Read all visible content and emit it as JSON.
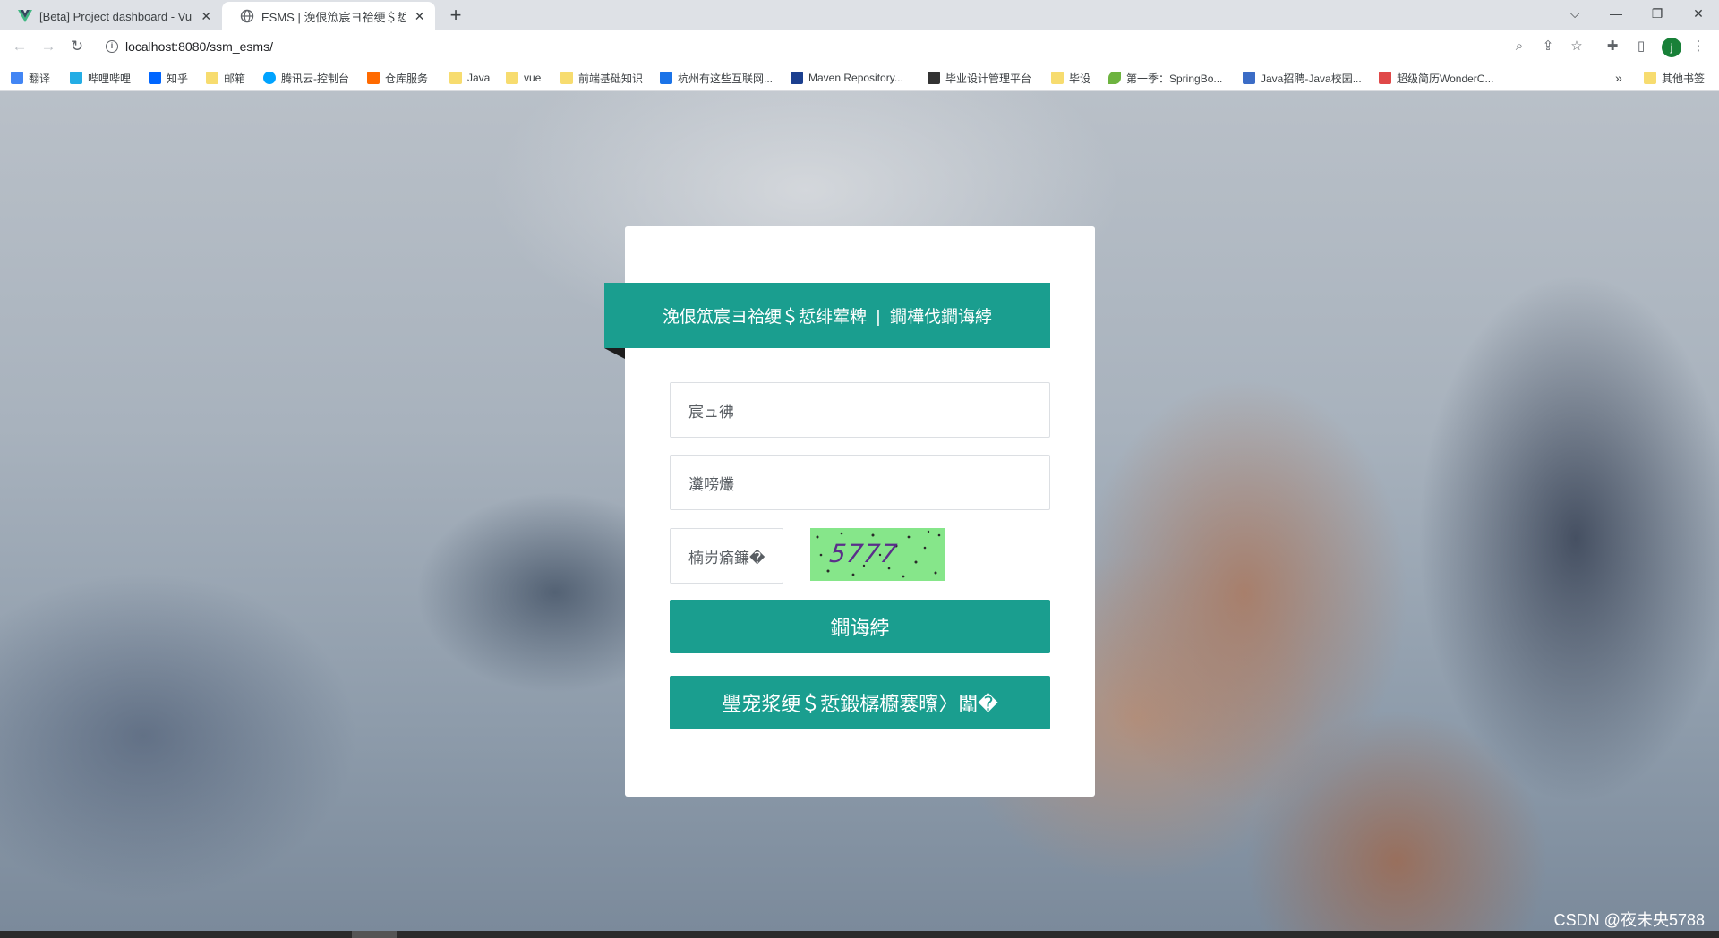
{
  "browser": {
    "tabs": [
      {
        "title": "[Beta] Project dashboard - Vue",
        "icon": "vue-logo-icon"
      },
      {
        "title": "ESMS | 浼佷笟宸ヨ祫绠＄悊绯荤粺",
        "icon": "globe-icon",
        "active": true
      }
    ],
    "url": "localhost:8080/ssm_esms/",
    "profile_initial": "j",
    "bookmarks": [
      {
        "label": "翻译",
        "icon": "translate-icon"
      },
      {
        "label": "哔哩哔哩",
        "icon": "bilibili-icon"
      },
      {
        "label": "知乎",
        "icon": "zhihu-icon"
      },
      {
        "label": "邮箱",
        "icon": "folder-icon"
      },
      {
        "label": "腾讯云-控制台",
        "icon": "tencent-cloud-icon"
      },
      {
        "label": "仓库服务",
        "icon": "aliyun-icon"
      },
      {
        "label": "Java",
        "icon": "folder-icon"
      },
      {
        "label": "vue",
        "icon": "folder-icon"
      },
      {
        "label": "前端基础知识",
        "icon": "folder-icon"
      },
      {
        "label": "杭州有这些互联网...",
        "icon": "site-icon"
      },
      {
        "label": "Maven Repository...",
        "icon": "maven-icon"
      },
      {
        "label": "毕业设计管理平台",
        "icon": "site-icon"
      },
      {
        "label": "毕设",
        "icon": "folder-icon"
      },
      {
        "label": "第一季：SpringBo...",
        "icon": "spring-icon"
      },
      {
        "label": "Java招聘-Java校园...",
        "icon": "site-icon"
      },
      {
        "label": "超级简历WonderC...",
        "icon": "site-icon"
      }
    ],
    "more_bookmarks": "»",
    "other_bookmarks": "其他书签"
  },
  "login": {
    "title": "浼佷笟宸ヨ祫绠＄悊绯荤粺  |  鐧樺伐鐧诲綍",
    "username_placeholder": "宸ュ彿",
    "password_placeholder": "瀵嗙爜",
    "captcha_placeholder": "楠岃瘉鐮�",
    "captcha_text": "5777",
    "login_button": "鐧诲綍",
    "admin_login_button": "璺宠浆绠＄悊鍛樼櫥褰曢〉闈�"
  },
  "watermark": "CSDN @夜未央5788",
  "colors": {
    "accent": "#1a9e8f",
    "captcha_bg": "#86e68a"
  }
}
